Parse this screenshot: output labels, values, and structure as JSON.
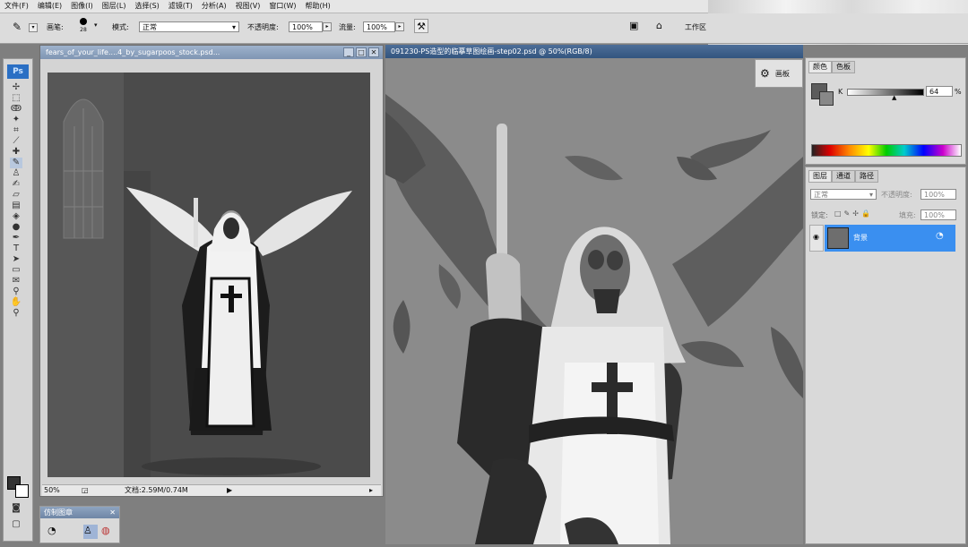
{
  "menu": [
    "文件(F)",
    "编辑(E)",
    "图像(I)",
    "图层(L)",
    "选择(S)",
    "滤镜(T)",
    "分析(A)",
    "视图(V)",
    "窗口(W)",
    "帮助(H)"
  ],
  "options": {
    "brush_label": "画笔:",
    "brush_size": "28",
    "mode_label": "模式:",
    "mode_value": "正常",
    "opacity_label": "不透明度:",
    "opacity_value": "100%",
    "flow_label": "流量:",
    "flow_value": "100%",
    "workspace_label": "工作区"
  },
  "toolbox": {
    "logo": "Ps"
  },
  "left_doc": {
    "title": "fears_of_your_life....4_by_sugarpoos_stock.psd...",
    "zoom": "50%",
    "doc_info": "文档:2.59M/0.74M"
  },
  "right_doc": {
    "title": "091230-PS造型的临摹草图绘画-step02.psd @ 50%(RGB/8)"
  },
  "mini_panel": {
    "title": "仿制图章"
  },
  "panel_button": {
    "label": "画板"
  },
  "color_panel": {
    "tabs": [
      "颜色",
      "色板"
    ],
    "k_label": "K",
    "k_value": "64",
    "k_unit": "%"
  },
  "layers_panel": {
    "tabs": [
      "图层",
      "通道",
      "路径"
    ],
    "blend_mode": "正常",
    "opacity_label": "不透明度:",
    "opacity_value": "100%",
    "lock_label": "锁定:",
    "fill_label": "填充:",
    "fill_value": "100%",
    "layer_name": "背景"
  },
  "colors": {
    "accent": "#2f8fe8",
    "selected_layer": "#3a8ff0"
  }
}
